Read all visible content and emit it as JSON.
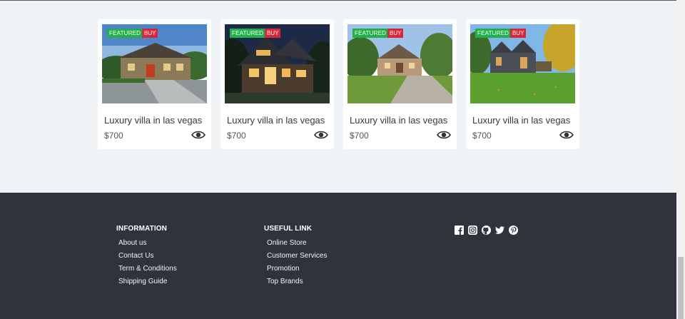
{
  "listings": [
    {
      "featured": "FEATURED",
      "buy": "BUY",
      "title": "Luxury villa in las vegas",
      "price": "$700"
    },
    {
      "featured": "FEATURED",
      "buy": "BUY",
      "title": "Luxury villa in las vegas",
      "price": "$700"
    },
    {
      "featured": "FEATURED",
      "buy": "BUY",
      "title": "Luxury villa in las vegas",
      "price": "$700"
    },
    {
      "featured": "FEATURED",
      "buy": "BUY",
      "title": "Luxury villa in las vegas",
      "price": "$700"
    }
  ],
  "footer": {
    "information": {
      "title": "INFORMATION",
      "links": [
        "About us",
        "Contact Us",
        "Term & Conditions",
        "Shipping Guide"
      ]
    },
    "useful": {
      "title": "USEFUL LINK",
      "links": [
        "Online Store",
        "Customer Services",
        "Promotion",
        "Top Brands"
      ]
    },
    "social_icons": [
      "facebook-icon",
      "instagram-icon",
      "github-icon",
      "twitter-icon",
      "pinterest-icon"
    ]
  },
  "colors": {
    "featured": "#23b04a",
    "buy": "#d9263a",
    "footer_bg": "#31333c",
    "page_bg": "#f0f3f6"
  }
}
